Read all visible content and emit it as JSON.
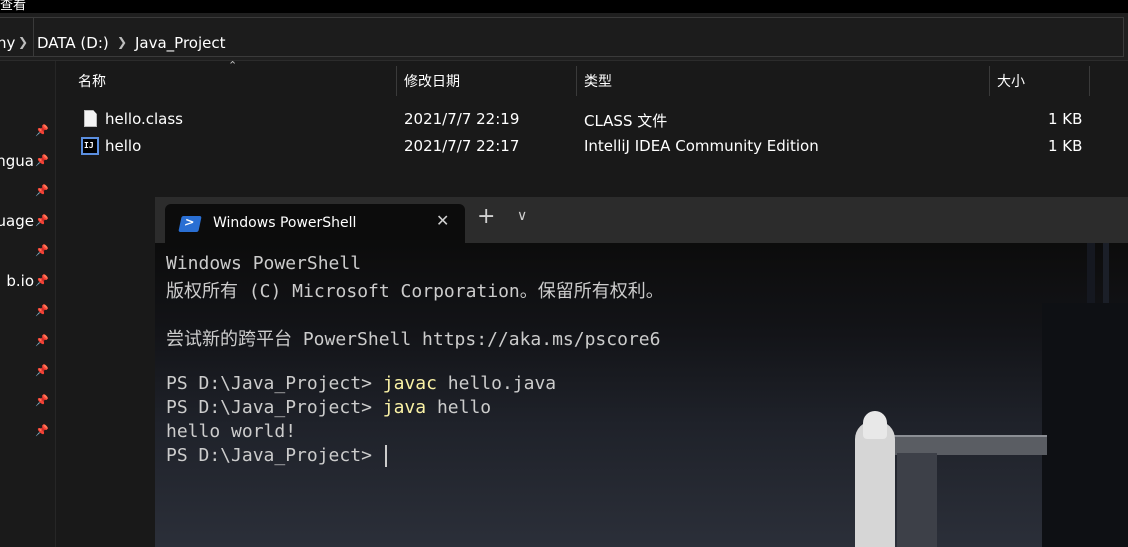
{
  "window": {
    "title_fragment": "查看"
  },
  "address_bar": {
    "crumbs": [
      "ny",
      "DATA (D:)",
      "Java_Project"
    ]
  },
  "nav_pane": {
    "items": [
      {
        "label": ""
      },
      {
        "label": "ngua"
      },
      {
        "label": ""
      },
      {
        "label": "uage"
      },
      {
        "label": ""
      },
      {
        "label": "b.io"
      },
      {
        "label": ""
      },
      {
        "label": ""
      },
      {
        "label": ""
      },
      {
        "label": ""
      },
      {
        "label": ""
      }
    ]
  },
  "file_list": {
    "columns": {
      "name": "名称",
      "modified": "修改日期",
      "type": "类型",
      "size": "大小"
    },
    "rows": [
      {
        "name": "hello.class",
        "modified": "2021/7/7 22:19",
        "type": "CLASS 文件",
        "size": "1 KB",
        "icon": "class-file-icon"
      },
      {
        "name": "hello",
        "modified": "2021/7/7 22:17",
        "type": "IntelliJ IDEA Community Edition",
        "size": "1 KB",
        "icon": "intellij-icon"
      }
    ]
  },
  "terminal": {
    "tab_title": "Windows PowerShell",
    "console": {
      "line1": "Windows PowerShell",
      "line2": "版权所有 (C) Microsoft Corporation。保留所有权利。",
      "line3": "尝试新的跨平台 PowerShell https://aka.ms/pscore6",
      "prompt": "PS D:\\Java_Project> ",
      "cmd1": "javac",
      "args1": " hello.java",
      "cmd2": "java",
      "args2": " hello",
      "output": "hello world!"
    }
  }
}
